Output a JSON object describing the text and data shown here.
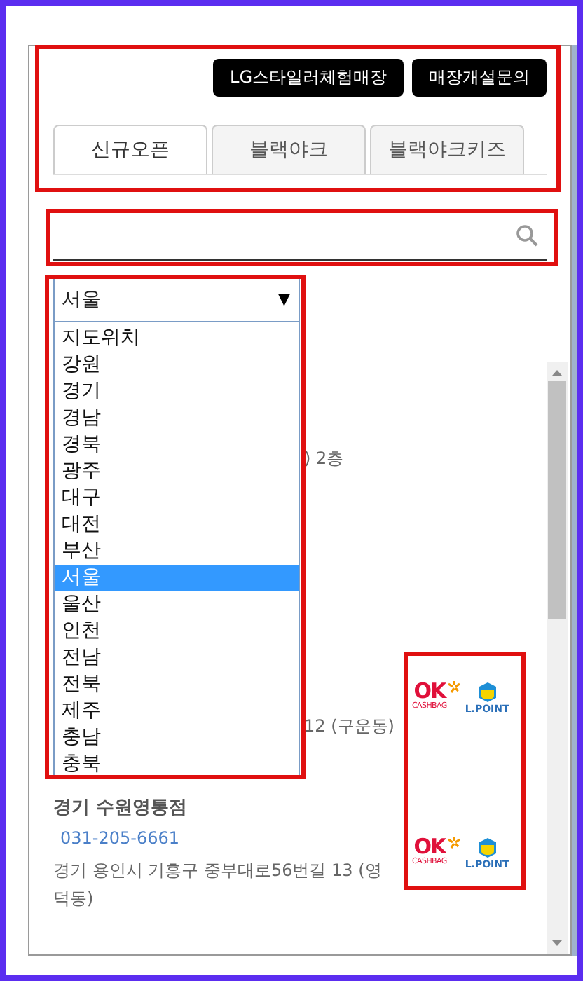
{
  "header_buttons": [
    "LG스타일러체험매장",
    "매장개설문의"
  ],
  "tabs": [
    {
      "label": "신규오픈",
      "selected": true
    },
    {
      "label": "블랙야크",
      "selected": false
    },
    {
      "label": "블랙야크키즈",
      "selected": false
    }
  ],
  "region_select": {
    "value": "서울",
    "arrow": "▼",
    "options": [
      {
        "label": "지도위치",
        "selected": false
      },
      {
        "label": "강원",
        "selected": false
      },
      {
        "label": "경기",
        "selected": false
      },
      {
        "label": "경남",
        "selected": false
      },
      {
        "label": "경북",
        "selected": false
      },
      {
        "label": "광주",
        "selected": false
      },
      {
        "label": "대구",
        "selected": false
      },
      {
        "label": "대전",
        "selected": false
      },
      {
        "label": "부산",
        "selected": false
      },
      {
        "label": "서울",
        "selected": true
      },
      {
        "label": "울산",
        "selected": false
      },
      {
        "label": "인천",
        "selected": false
      },
      {
        "label": "전남",
        "selected": false
      },
      {
        "label": "전북",
        "selected": false
      },
      {
        "label": "제주",
        "selected": false
      },
      {
        "label": "충남",
        "selected": false
      },
      {
        "label": "충북",
        "selected": false
      }
    ]
  },
  "stores": [
    {
      "address": ") 2층"
    },
    {
      "address": "12 (구운동)",
      "logos": {
        "ok": "OK",
        "ok_sub": "CASHBAG",
        "lpoint": "L.POINT"
      }
    },
    {
      "name": "경기 수원영통점",
      "phone": "031-205-6661",
      "address": "경기 용인시 기흥구 중부대로56번길 13 (영덕동)",
      "logos": {
        "ok": "OK",
        "ok_sub": "CASHBAG",
        "lpoint": "L.POINT"
      }
    }
  ]
}
